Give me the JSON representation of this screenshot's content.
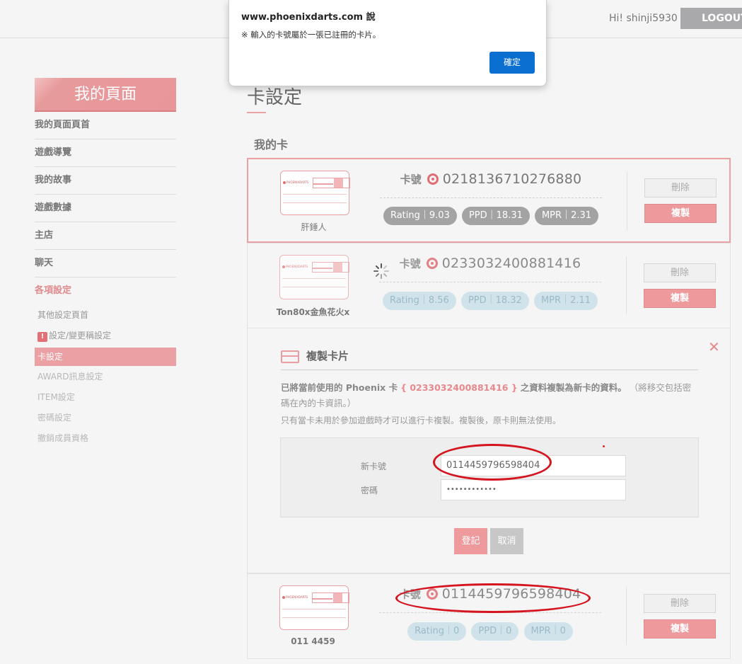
{
  "header": {
    "greeting": "Hi! shinji5930",
    "logout_label": "LOGOUT"
  },
  "dialog": {
    "title": "www.phoenixdarts.com 說",
    "message": "※ 輸入的卡號屬於一張已註冊的卡片。",
    "ok_label": "確定"
  },
  "sidebar": {
    "title": "我的頁面",
    "items": [
      {
        "label": "我的頁面頁首"
      },
      {
        "label": "遊戲導覽"
      },
      {
        "label": "我的故事"
      },
      {
        "label": "遊戲數據"
      },
      {
        "label": "主店"
      },
      {
        "label": "聊天"
      },
      {
        "label": "各項設定"
      }
    ],
    "sub_items": [
      {
        "label": "其他設定頁首"
      },
      {
        "label": "設定/變更稱設定",
        "badge": "!"
      },
      {
        "label": "卡設定"
      },
      {
        "label": "AWARD訊息設定"
      },
      {
        "label": "ITEM設定"
      },
      {
        "label": "密碼設定"
      },
      {
        "label": "撤銷成員資格"
      }
    ]
  },
  "main": {
    "page_title": "卡設定",
    "section_title": "我的卡",
    "card_number_label": "卡號",
    "thumb_logo": "PHOENIXDARTS",
    "delete_label": "刪除",
    "copy_label": "複製",
    "cards": [
      {
        "name": "肝錘人",
        "number": "0218136710276880",
        "stats": [
          {
            "label": "Rating",
            "value": "9.03"
          },
          {
            "label": "PPD",
            "value": "18.31"
          },
          {
            "label": "MPR",
            "value": "2.31"
          }
        ]
      },
      {
        "name": "Ton80x金魚花火x",
        "number": "0233032400881416",
        "stats": [
          {
            "label": "Rating",
            "value": "8.56"
          },
          {
            "label": "PPD",
            "value": "18.32"
          },
          {
            "label": "MPR",
            "value": "2.11"
          }
        ]
      },
      {
        "name": "011 4459",
        "number": "0114459796598404",
        "stats": [
          {
            "label": "Rating",
            "value": "0"
          },
          {
            "label": "PPD",
            "value": "0"
          },
          {
            "label": "MPR",
            "value": "0"
          }
        ]
      }
    ],
    "copy_panel": {
      "title": "複製卡片",
      "close": "✕",
      "desc_prefix": "已將當前使用的 Phoenix 卡",
      "desc_card": "{ 0233032400881416 }",
      "desc_suffix": "之資料複製為新卡的資料。",
      "desc_note": "（將移交包括密碼在內的卡資訊。）",
      "desc2": "只有當卡未用於參加遊戲時才可以進行卡複製。複製後，原卡則無法使用。",
      "new_card_label": "新卡號",
      "new_card_value": "0114459796598404",
      "password_label": "密碼",
      "password_value": "••••••••••••",
      "register_label": "登記",
      "cancel_label": "取消"
    }
  }
}
